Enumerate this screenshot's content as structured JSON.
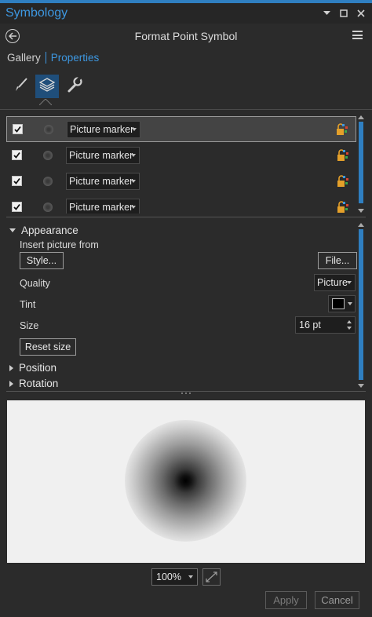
{
  "window": {
    "title": "Symbology",
    "accent_color": "#3d97e0",
    "menu_icon": "chevron-down-icon",
    "pin_icon": "restore-icon",
    "close_icon": "close-icon"
  },
  "header": {
    "title": "Format Point Symbol",
    "back_icon": "back-arrow-icon",
    "menu_icon": "hamburger-menu-icon"
  },
  "subnav": {
    "gallery": "Gallery",
    "properties": "Properties"
  },
  "tabs": [
    {
      "icon": "paintbrush-icon",
      "active": false
    },
    {
      "icon": "layers-icon",
      "active": true
    },
    {
      "icon": "wrench-icon",
      "active": false
    }
  ],
  "layers": [
    {
      "checked": true,
      "type": "Picture marker",
      "selected": true
    },
    {
      "checked": true,
      "type": "Picture marker",
      "selected": false
    },
    {
      "checked": true,
      "type": "Picture marker",
      "selected": false
    },
    {
      "checked": true,
      "type": "Picture marker",
      "selected": false
    }
  ],
  "appearance": {
    "heading": "Appearance",
    "insert_label": "Insert picture from",
    "style_button": "Style...",
    "file_button": "File...",
    "quality_label": "Quality",
    "quality_value": "Picture",
    "tint_label": "Tint",
    "tint_color": "#000000",
    "size_label": "Size",
    "size_value": "16 pt",
    "reset_button": "Reset size"
  },
  "sections": {
    "position": "Position",
    "rotation": "Rotation"
  },
  "preview": {
    "zoom": "100%"
  },
  "footer": {
    "apply": "Apply",
    "cancel": "Cancel"
  }
}
